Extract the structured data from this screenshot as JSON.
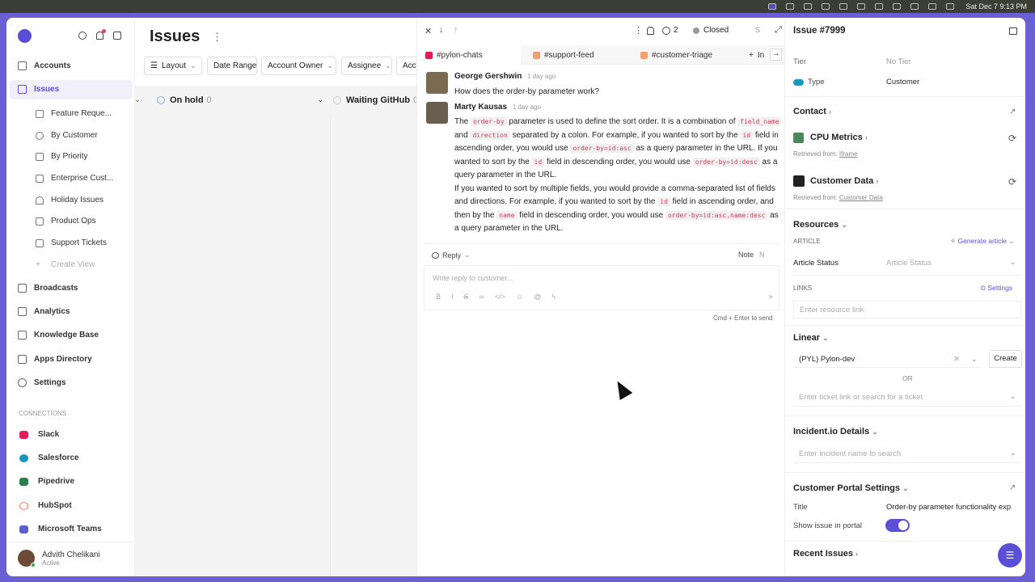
{
  "menubar": {
    "clock": "Sat Dec 7  9:13 PM"
  },
  "sidebar": {
    "items": [
      {
        "label": "Accounts"
      },
      {
        "label": "Issues"
      }
    ],
    "views": [
      {
        "label": "Feature Reque..."
      },
      {
        "label": "By Customer"
      },
      {
        "label": "By Priority"
      },
      {
        "label": "Enterprise Cust..."
      },
      {
        "label": "Holiday Issues"
      },
      {
        "label": "Product Ops"
      },
      {
        "label": "Support Tickets"
      },
      {
        "label": "Create View"
      }
    ],
    "more": [
      {
        "label": "Broadcasts"
      },
      {
        "label": "Analytics"
      },
      {
        "label": "Knowledge Base"
      },
      {
        "label": "Apps Directory"
      },
      {
        "label": "Settings"
      }
    ],
    "connections_label": "CONNECTIONS",
    "connections": [
      {
        "label": "Slack",
        "color": "#e01e5a"
      },
      {
        "label": "Salesforce",
        "color": "#1798c1"
      },
      {
        "label": "Pipedrive",
        "color": "#2e7d4f"
      },
      {
        "label": "HubSpot",
        "color": "#ff7a59"
      },
      {
        "label": "Microsoft Teams",
        "color": "#5b5fc7"
      }
    ],
    "user": {
      "name": "Advith Chelikani",
      "status": "Active"
    }
  },
  "main": {
    "title": "Issues",
    "filters": [
      "Layout",
      "Date Range",
      "Account Owner",
      "Assignee",
      "Acc"
    ],
    "columns": [
      {
        "name": "On hold",
        "count": "0"
      },
      {
        "name": "Waiting GitHub",
        "count": "0"
      }
    ]
  },
  "conversation": {
    "status": "Closed",
    "watchers": "2",
    "status_extra": "S",
    "tabs": [
      "#pylon-chats",
      "#support-feed",
      "#customer-triage",
      "In"
    ],
    "messages": [
      {
        "author": "George Gershwin",
        "time": "1 day ago",
        "text": "How does the order-by parameter work?"
      },
      {
        "author": "Marty Kausas",
        "time": "1 day ago"
      }
    ],
    "reply_label": "Reply",
    "note_label": "Note",
    "note_extra": "N",
    "reply_placeholder": "Write reply to customer...",
    "send_hint": "Cmd + Enter to send"
  },
  "issue": {
    "title": "Issue #7999",
    "tier_label": "Tier",
    "tier_value": "No Tier",
    "type_label": "Type",
    "type_value": "Customer",
    "contact": "Contact",
    "cpu_metrics": "CPU Metrics",
    "retrieved_from": "Retrieved from:",
    "cpu_source": "Iframe",
    "customer_data": "Customer Data",
    "customer_source": "Customer Data",
    "resources": "Resources",
    "article": "ARTICLE",
    "generate_article": "Generate article",
    "article_status_label": "Article Status",
    "article_status_placeholder": "Article Status",
    "links": "LINKS",
    "settings": "Settings",
    "resource_placeholder": "Enter resource link",
    "linear": "Linear",
    "linear_team": "(PYL) Pylon-dev",
    "create": "Create",
    "or": "OR",
    "ticket_placeholder": "Enter ticket link or search for a ticket",
    "incident": "Incident.io Details",
    "incident_placeholder": "Enter incident name to search",
    "portal": "Customer Portal Settings",
    "portal_title_label": "Title",
    "portal_title_value": "Order-by parameter functionality exp",
    "show_in_portal_label": "Show issue in portal",
    "show_in_portal": true,
    "recent_issues": "Recent Issues"
  },
  "colors": {
    "accent": "#5b4fd6",
    "frame": "#6a5fd3"
  }
}
